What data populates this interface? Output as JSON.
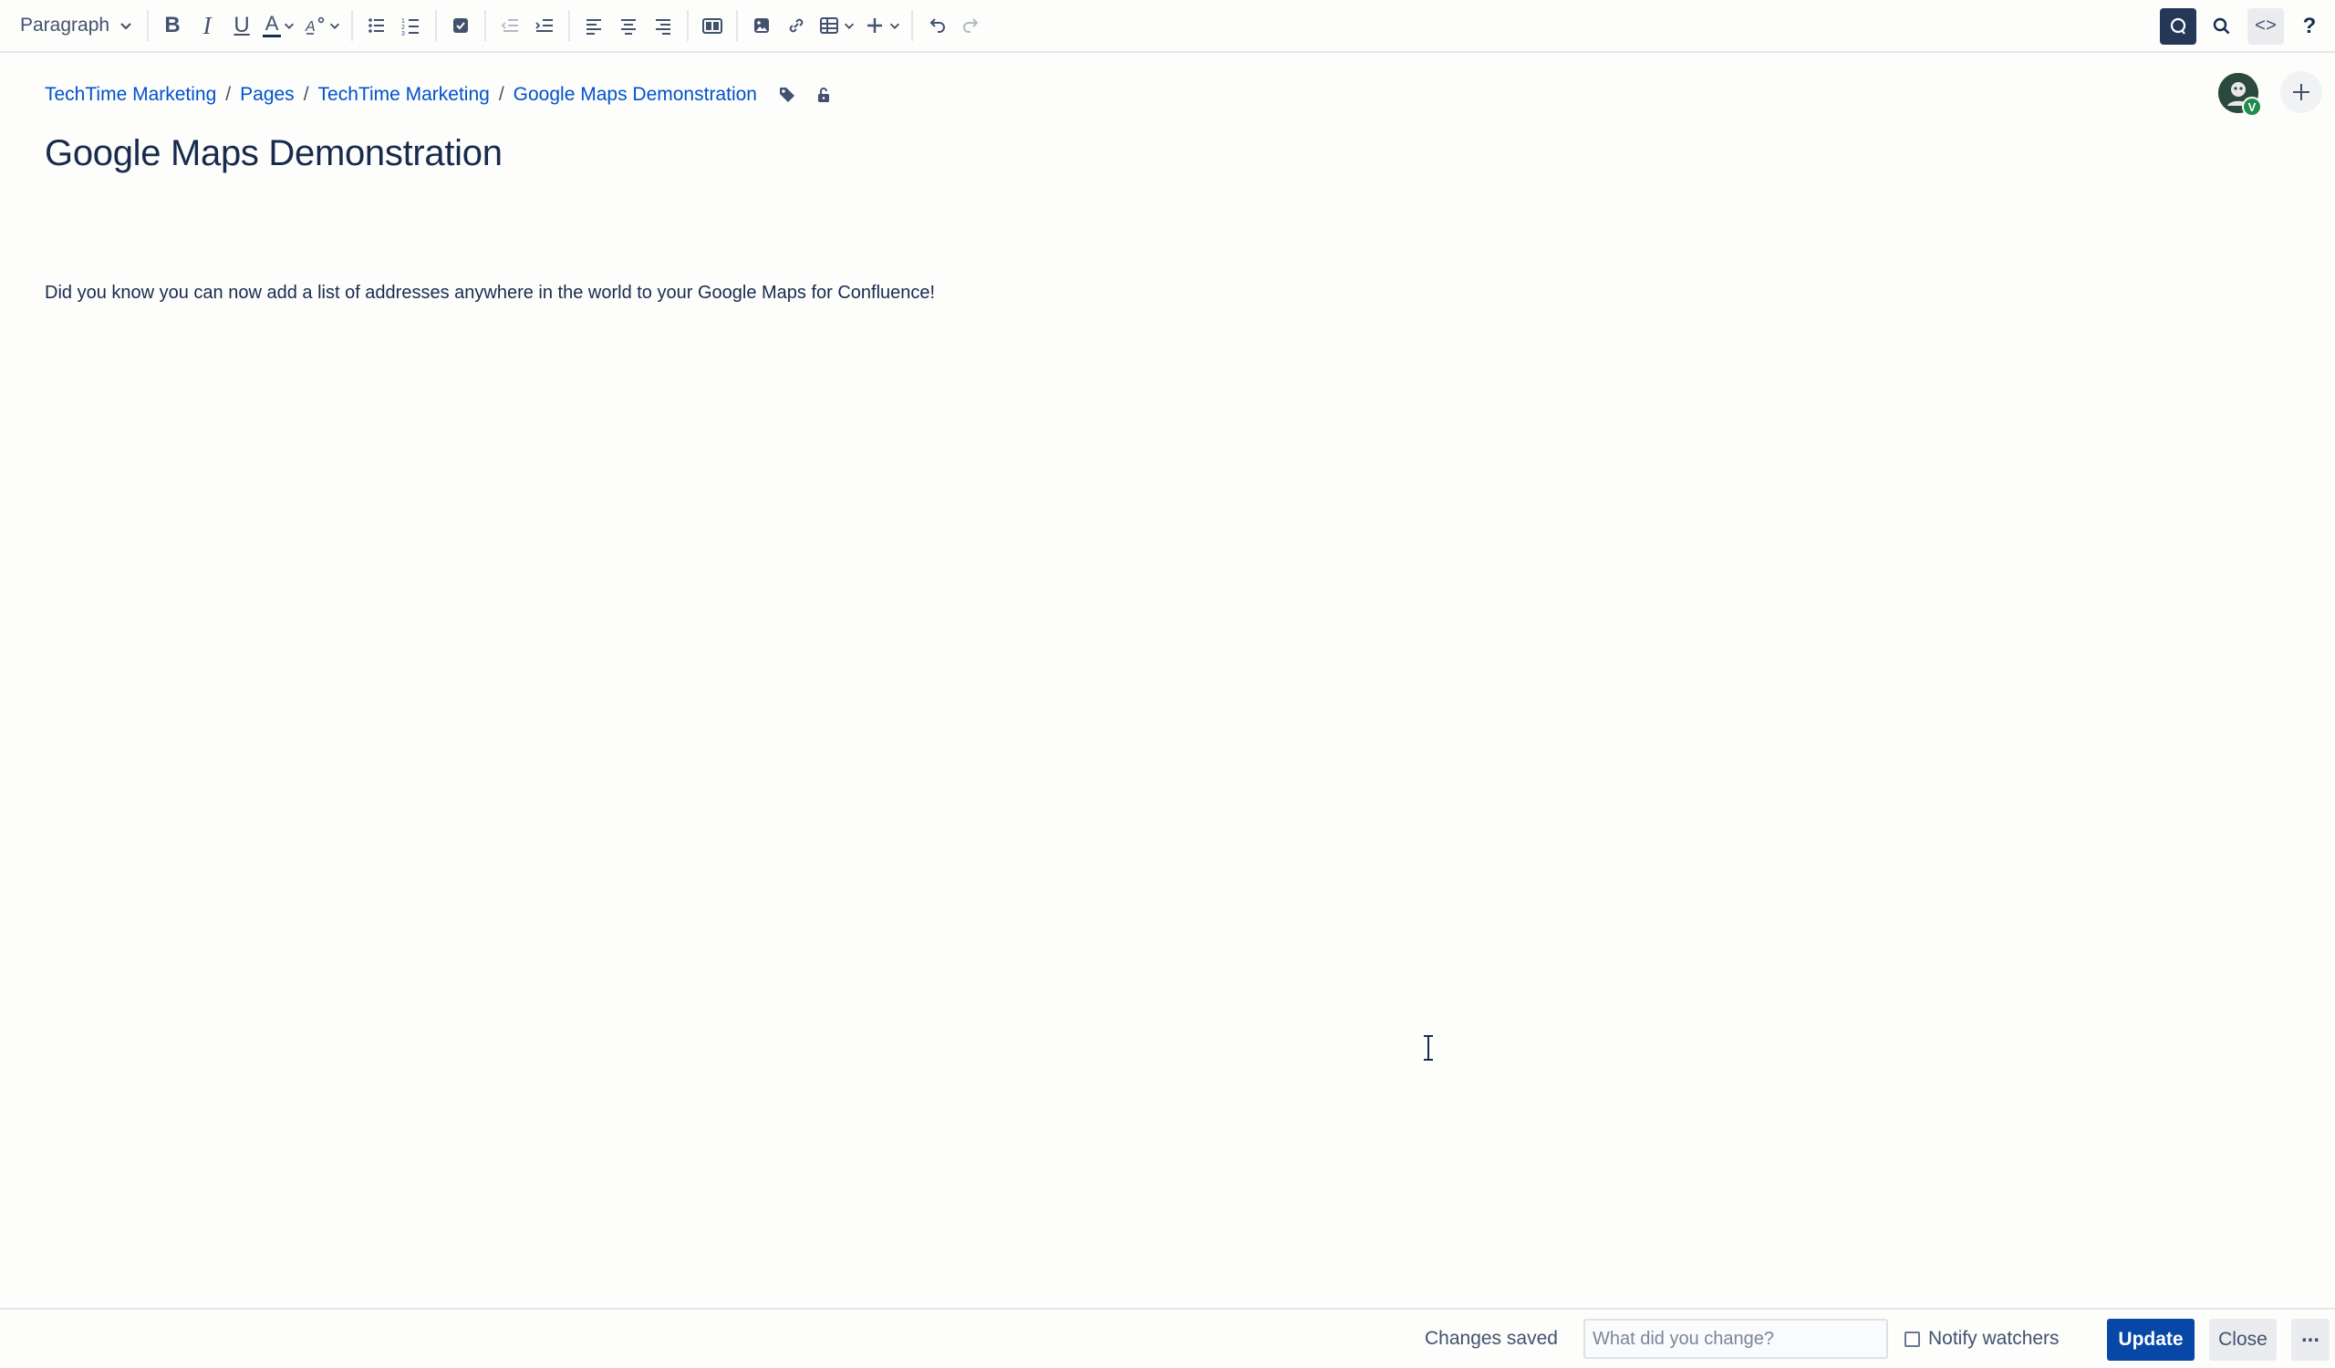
{
  "toolbar": {
    "text_style": "Paragraph",
    "bold_label": "B",
    "italic_label": "I",
    "underline_label": "U",
    "text_color_label": "A",
    "code_label": "<>",
    "help_label": "?"
  },
  "breadcrumb": {
    "items": [
      "TechTime Marketing",
      "Pages",
      "TechTime Marketing",
      "Google Maps Demonstration"
    ],
    "separator": "/"
  },
  "page": {
    "title": "Google Maps Demonstration",
    "body": "Did you know you can now add a list of addresses anywhere in the world to your Google Maps for Confluence!"
  },
  "collaborator": {
    "presence_letter": "V"
  },
  "footer": {
    "status": "Changes saved",
    "change_placeholder": "What did you change?",
    "notify_label": "Notify watchers",
    "notify_checked": false,
    "update_label": "Update",
    "close_label": "Close",
    "more_label": "..."
  },
  "colors": {
    "link": "#0052cc",
    "primary_button": "#0747a6",
    "text": "#172b4d",
    "presence": "#1f8b4c"
  }
}
